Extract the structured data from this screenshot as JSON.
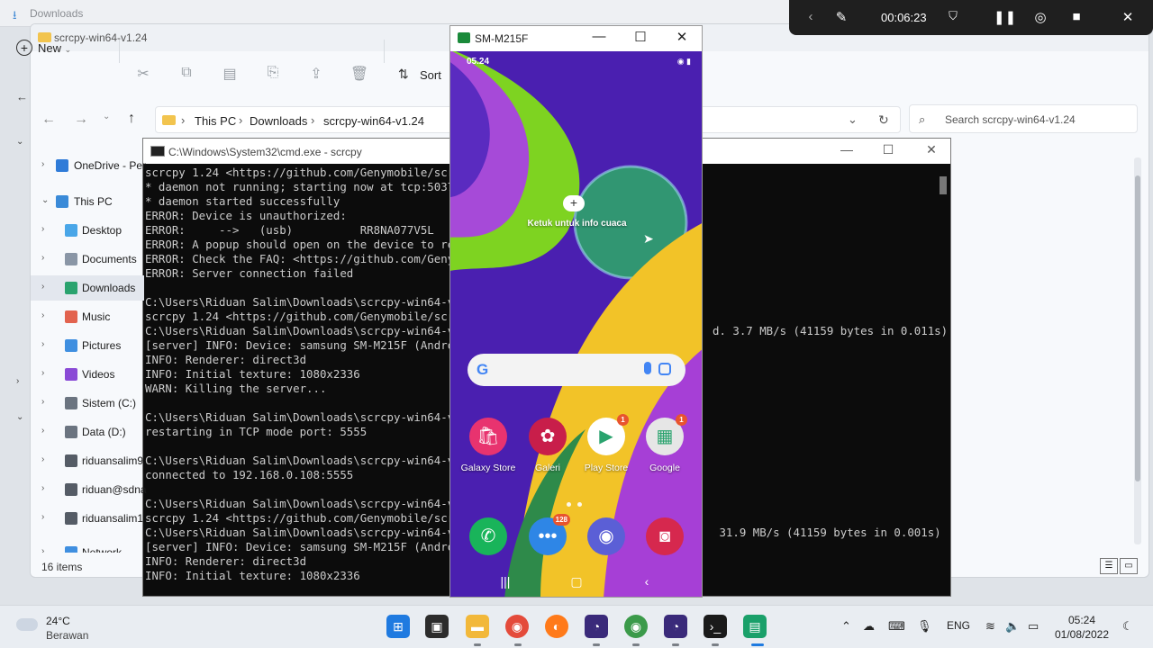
{
  "background_window": {
    "title": "Downloads"
  },
  "explorer": {
    "title": "scrcpy-win64-v1.24",
    "toolbar": {
      "new_label": "New",
      "sort_label": "Sort"
    },
    "breadcrumb": [
      "This PC",
      "Downloads",
      "scrcpy-win64-v1.24"
    ],
    "search_placeholder": "Search scrcpy-win64-v1.24",
    "sidebar": [
      {
        "label": "OneDrive - Per",
        "icon": "cloud-icon",
        "color": "#2f7bd8"
      },
      {
        "label": "This PC",
        "icon": "computer-icon",
        "color": "#3a8ad8"
      },
      {
        "label": "Desktop",
        "icon": "desktop-icon",
        "color": "#49a6e8"
      },
      {
        "label": "Documents",
        "icon": "document-icon",
        "color": "#8a96a6"
      },
      {
        "label": "Downloads",
        "icon": "download-icon",
        "color": "#2aa36e",
        "selected": true
      },
      {
        "label": "Music",
        "icon": "music-icon",
        "color": "#e2634f"
      },
      {
        "label": "Pictures",
        "icon": "pictures-icon",
        "color": "#3f8fe0"
      },
      {
        "label": "Videos",
        "icon": "videos-icon",
        "color": "#8a4ad6"
      },
      {
        "label": "Sistem (C:)",
        "icon": "drive-icon",
        "color": "#6b7480"
      },
      {
        "label": "Data (D:)",
        "icon": "drive-icon",
        "color": "#6b7480"
      },
      {
        "label": "riduansalim9",
        "icon": "network-drive-icon",
        "color": "#555c66"
      },
      {
        "label": "riduan@sdna",
        "icon": "network-drive-icon",
        "color": "#555c66"
      },
      {
        "label": "riduansalim1",
        "icon": "network-drive-icon",
        "color": "#555c66"
      },
      {
        "label": "Network",
        "icon": "network-icon",
        "color": "#3f8fe0"
      }
    ],
    "status": "16 items"
  },
  "cmd": {
    "title": "C:\\Windows\\System32\\cmd.exe - scrcpy",
    "lines": [
      "scrcpy 1.24 <https://github.com/Genymobile/scr",
      "* daemon not running; starting now at tcp:5037",
      "* daemon started successfully",
      "ERROR: Device is unauthorized:",
      "ERROR:     -->   (usb)          RR8NA077V5L",
      "ERROR: A popup should open on the device to re",
      "ERROR: Check the FAQ: <https://github.com/Geny",
      "ERROR: Server connection failed",
      "",
      "C:\\Users\\Riduan Salim\\Downloads\\scrcpy-win64-v1",
      "scrcpy 1.24 <https://github.com/Genymobile/scr",
      "C:\\Users\\Riduan Salim\\Downloads\\scrcpy-win64-v1",
      "[server] INFO: Device: samsung SM-M215F (Andro",
      "INFO: Renderer: direct3d",
      "INFO: Initial texture: 1080x2336",
      "WARN: Killing the server...",
      "",
      "C:\\Users\\Riduan Salim\\Downloads\\scrcpy-win64-v1",
      "restarting in TCP mode port: 5555",
      "",
      "C:\\Users\\Riduan Salim\\Downloads\\scrcpy-win64-v1",
      "connected to 192.168.0.108:5555",
      "",
      "C:\\Users\\Riduan Salim\\Downloads\\scrcpy-win64-v1",
      "scrcpy 1.24 <https://github.com/Genymobile/scr",
      "C:\\Users\\Riduan Salim\\Downloads\\scrcpy-win64-v1",
      "[server] INFO: Device: samsung SM-M215F (Andro",
      "INFO: Renderer: direct3d",
      "INFO: Initial texture: 1080x2336"
    ],
    "right_fragment_1": "d. 3.7 MB/s (41159 bytes in 0.011s)",
    "right_fragment_2": " 31.9 MB/s (41159 bytes in 0.001s)"
  },
  "phone": {
    "window_title": "SM-M215F",
    "status_time": "05.24",
    "weather_label": "Ketuk untuk info cuaca",
    "apps_row1": [
      {
        "label": "Galaxy Store",
        "icon": "galaxy-store-icon",
        "color": "#e8336f"
      },
      {
        "label": "Galeri",
        "icon": "gallery-icon",
        "color": "#c81e4a"
      },
      {
        "label": "Play Store",
        "icon": "play-store-icon",
        "color": "#ffffff",
        "badge": "1"
      },
      {
        "label": "Google",
        "icon": "google-folder-icon",
        "color": "#e6e6e6",
        "badge": "1"
      }
    ],
    "dock": [
      {
        "icon": "phone-icon",
        "color": "#19b45a"
      },
      {
        "icon": "messages-icon",
        "color": "#2e86e6",
        "badge": "128"
      },
      {
        "icon": "internet-icon",
        "color": "#5b5fd6"
      },
      {
        "icon": "camera-icon",
        "color": "#d6284e"
      }
    ]
  },
  "recorder": {
    "time": "00:06:23"
  },
  "taskbar": {
    "weather_temp": "24°C",
    "weather_cond": "Berawan",
    "lang": "ENG",
    "time": "05:24",
    "date": "01/08/2022"
  }
}
